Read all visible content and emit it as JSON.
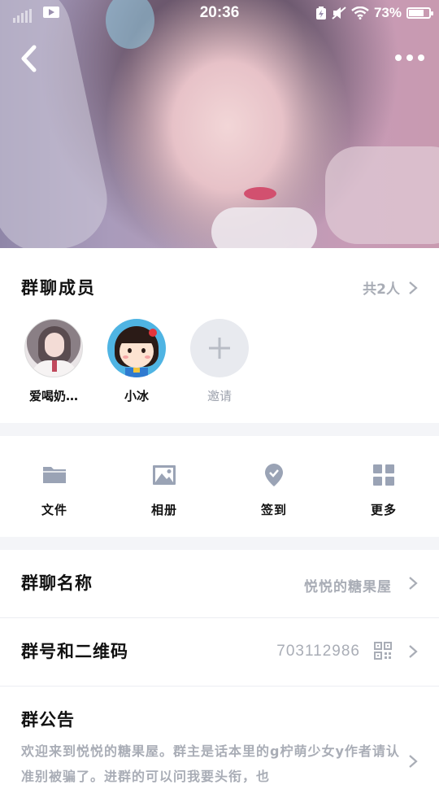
{
  "status_bar": {
    "time": "20:36",
    "battery": "73%",
    "battery_level": 0.73,
    "icons": [
      "signal-icon",
      "video-icon",
      "battery-charging-icon",
      "mute-icon",
      "wifi-icon",
      "battery-icon"
    ]
  },
  "header": {
    "back_icon": "chevron-left-icon",
    "more_icon": "more-dots-icon"
  },
  "members": {
    "title": "群聊成员",
    "count": "共2人",
    "list": [
      {
        "name": "爱喝奶…",
        "avatar": "photo-avatar"
      },
      {
        "name": "小冰",
        "avatar": "cartoon-girl-avatar"
      }
    ],
    "invite_label": "邀请"
  },
  "tools": [
    {
      "label": "文件",
      "icon": "folder-icon"
    },
    {
      "label": "相册",
      "icon": "image-icon"
    },
    {
      "label": "签到",
      "icon": "checkin-pin-icon"
    },
    {
      "label": "更多",
      "icon": "grid-icon"
    }
  ],
  "settings": {
    "group_name": {
      "label": "群聊名称",
      "value": "悦悦的糖果屋"
    },
    "group_number": {
      "label": "群号和二维码",
      "value": "703112986",
      "icon": "qr-code-icon"
    },
    "notice": {
      "label": "群公告",
      "text": "欢迎来到悦悦的糖果屋。群主是话本里的g柠萌少女y作者请认准别被骗了。进群的可以问我要头衔，也"
    }
  },
  "colors": {
    "accent_grey": "#a9adb6",
    "icon_grey": "#9aa3b5",
    "divider": "#eceef2",
    "section_gap": "#f4f5f8"
  }
}
